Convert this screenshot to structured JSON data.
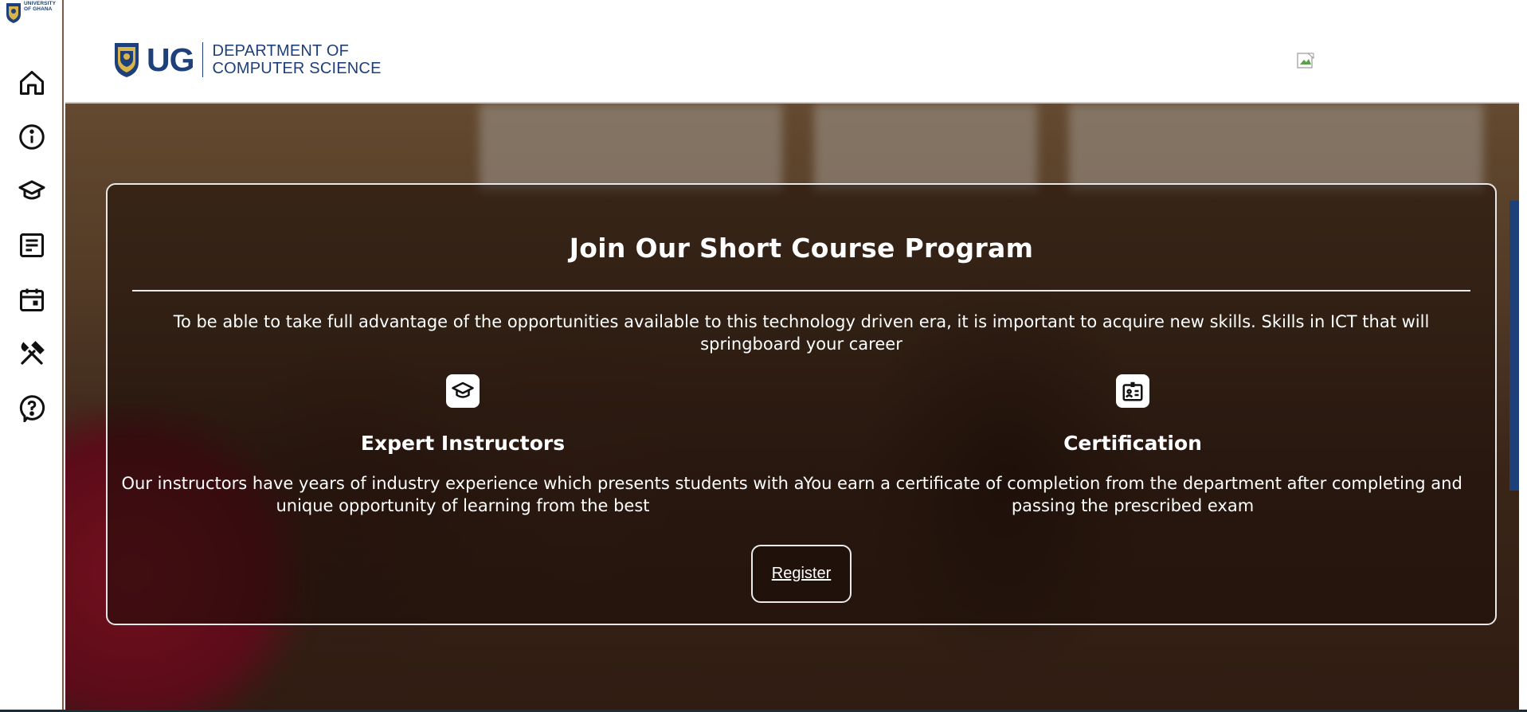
{
  "rail": {
    "logo_text": "UNIVERSITY\nOF GHANA",
    "items": [
      {
        "icon": "home-icon"
      },
      {
        "icon": "info-icon"
      },
      {
        "icon": "graduation-cap-icon"
      },
      {
        "icon": "article-icon"
      },
      {
        "icon": "calendar-icon"
      },
      {
        "icon": "tools-icon"
      },
      {
        "icon": "help-icon"
      }
    ]
  },
  "header": {
    "brand_short": "UG",
    "dept_line1": "DEPARTMENT OF",
    "dept_line2": "COMPUTER SCIENCE"
  },
  "card": {
    "title": "Join Our Short Course Program",
    "intro": "To be able to take full advantage of the opportunities available to this technology driven era, it is important to acquire new skills. Skills in ICT that will springboard your career",
    "features": [
      {
        "icon": "graduation-cap-icon",
        "title": "Expert Instructors",
        "body": "Our instructors have years of industry experience which presents students with a unique opportunity of learning from the best"
      },
      {
        "icon": "id-badge-icon",
        "title": "Certification",
        "body": "You earn a certificate of completion from the department after completing and passing the prescribed exam"
      }
    ],
    "register_label": "Register"
  },
  "colors": {
    "brand_blue": "#1d3f7a",
    "rail_border": "#7a5a45",
    "card_border": "#e8e8e8"
  }
}
